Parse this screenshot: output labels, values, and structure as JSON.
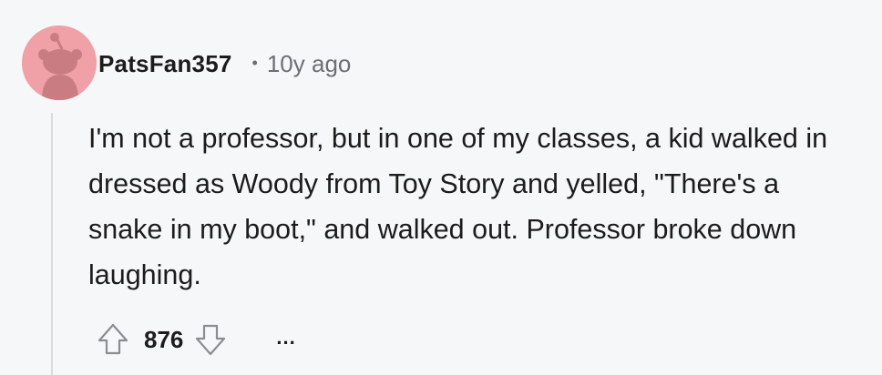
{
  "comment": {
    "username": "PatsFan357",
    "separator": "•",
    "timestamp": "10y ago",
    "body": "I'm not a professor, but in one of my classes, a kid walked in dressed as Woody from Toy Story and yelled, \"There's a snake in my boot,\" and walked out. Professor broke down laughing.",
    "score": "876",
    "more_label": "..."
  },
  "avatar": {
    "background": "#f0a1a7",
    "figure_color": "#c97d83"
  },
  "icons": {
    "upvote": "arrow-up-outline-icon",
    "downvote": "arrow-down-outline-icon",
    "more": "ellipsis-icon"
  }
}
